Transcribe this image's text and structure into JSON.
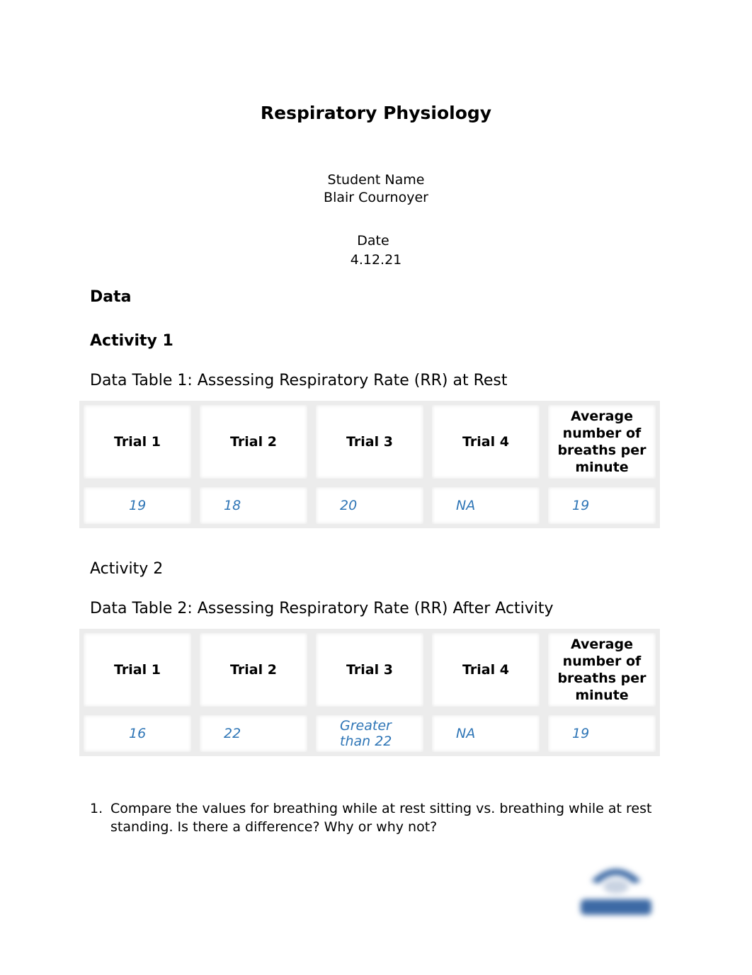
{
  "document": {
    "title": "Respiratory Physiology",
    "student_label": "Student Name",
    "student_name": "Blair Cournoyer",
    "date_label": "Date",
    "date_value": "4.12.21",
    "section_heading": "Data",
    "activity1_heading": "Activity 1",
    "table1": {
      "caption": "Data Table 1: Assessing Respiratory Rate (RR) at Rest",
      "headers": [
        "Trial 1",
        "Trial 2",
        "Trial 3",
        "Trial 4",
        "Average number of breaths per minute"
      ],
      "values": [
        "19",
        "18",
        "20",
        "NA",
        "19"
      ]
    },
    "activity2_heading": "Activity 2",
    "table2": {
      "caption": "Data Table 2: Assessing Respiratory Rate (RR) After Activity",
      "headers": [
        "Trial 1",
        "Trial 2",
        "Trial 3",
        "Trial 4",
        "Average number of breaths per minute"
      ],
      "values": [
        "16",
        "22",
        "Greater than 22",
        "NA",
        "19"
      ]
    },
    "questions": [
      {
        "number": "1.",
        "text": "Compare the values for breathing while at rest sitting vs. breathing while at rest standing. Is there a difference? Why or why not?"
      }
    ],
    "logo_icon": "institution-logo-icon",
    "colors": {
      "answer_text": "#2e75b6",
      "logo": "#3d6aa5"
    }
  }
}
